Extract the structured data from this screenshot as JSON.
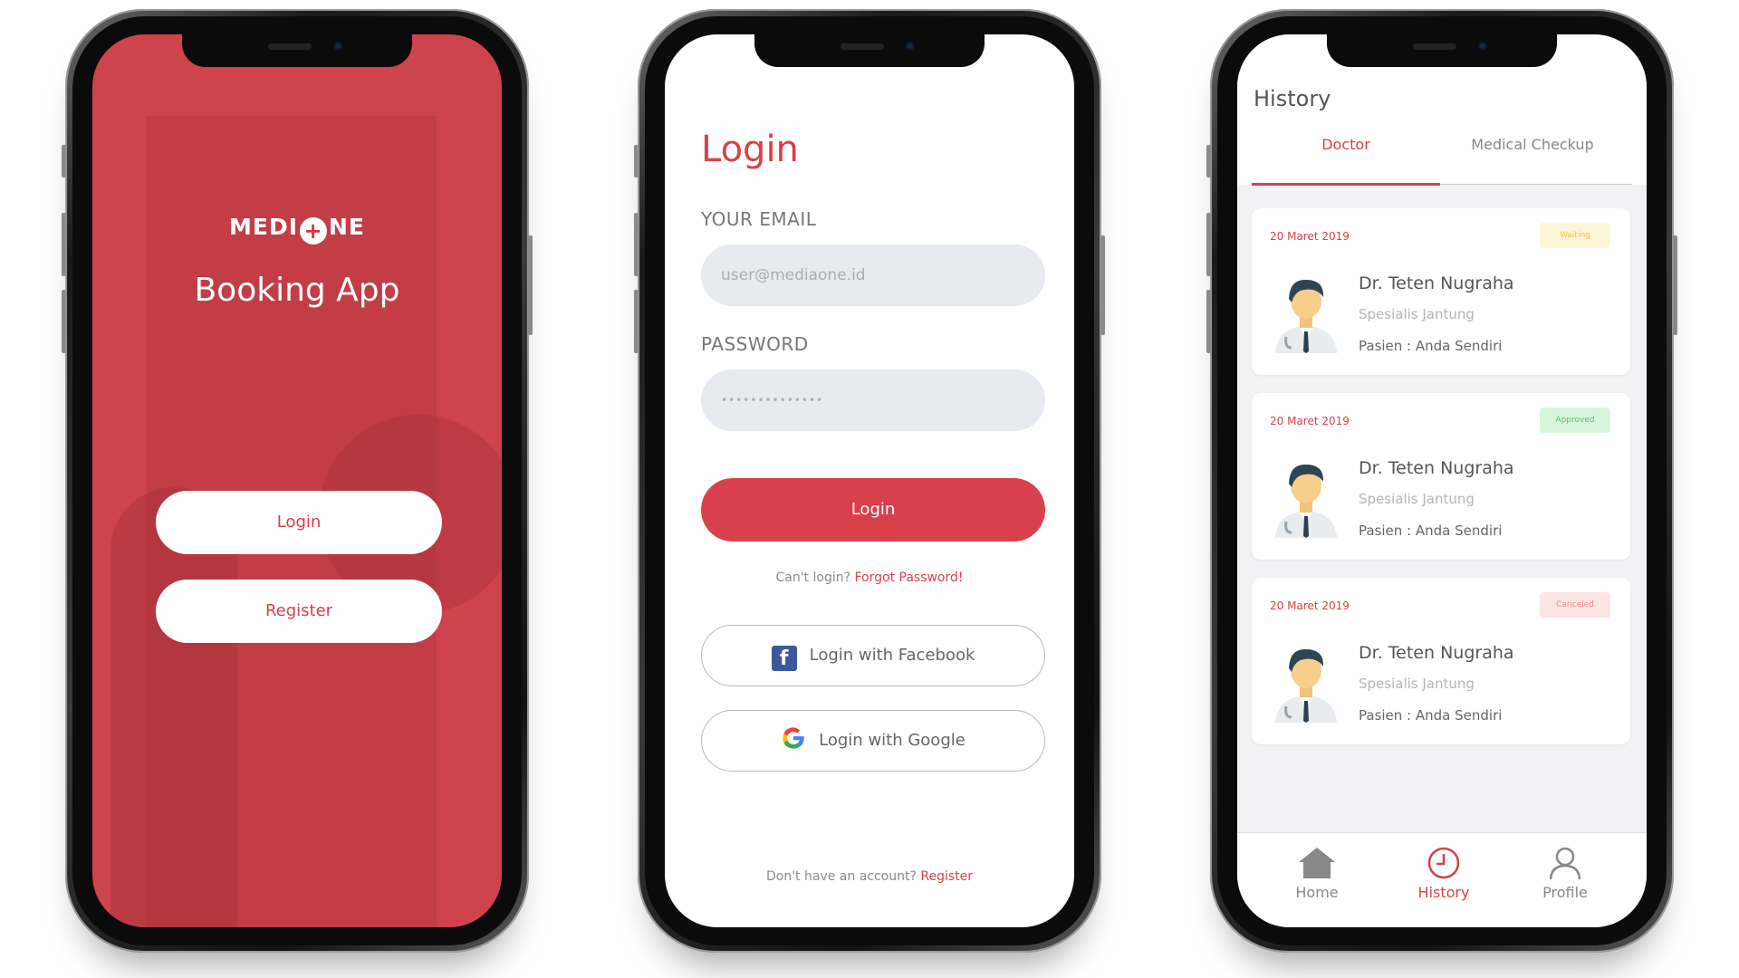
{
  "screen1": {
    "logo_left": "MEDI",
    "logo_right": "NE",
    "app_title": "Booking App",
    "login_label": "Login",
    "register_label": "Register"
  },
  "screen2": {
    "title": "Login",
    "email_label": "YOUR EMAIL",
    "email_value": "user@mediaone.id",
    "password_label": "PASSWORD",
    "password_value": "••••••••••••••",
    "login_button": "Login",
    "cant_login": "Can't login?",
    "forgot_password": "Forgot Password!",
    "facebook_button": "Login with Facebook",
    "google_button": "Login with Google",
    "no_account": "Don't have an account?",
    "register_link": "Register"
  },
  "screen3": {
    "title": "History",
    "tabs": [
      {
        "label": "Doctor"
      },
      {
        "label": "Medical Checkup"
      }
    ],
    "cards": [
      {
        "date": "20 Maret 2019",
        "status": "Waiting",
        "status_color": "#e6c452",
        "doctor": "Dr. Teten Nugraha",
        "specialty": "Spesialis Jantung",
        "patient": "Pasien : Anda Sendiri"
      },
      {
        "date": "20 Maret 2019",
        "status": "Approved",
        "status_color": "#5bbf6a",
        "doctor": "Dr. Teten Nugraha",
        "specialty": "Spesialis Jantung",
        "patient": "Pasien : Anda Sendiri"
      },
      {
        "date": "20 Maret 2019",
        "status": "Canceled",
        "status_color": "#ec8a8a",
        "doctor": "Dr. Teten Nugraha",
        "specialty": "Spesialis Jantung",
        "patient": "Pasien : Anda Sendiri"
      }
    ],
    "nav": [
      {
        "label": "Home",
        "icon": "home-icon"
      },
      {
        "label": "History",
        "icon": "clock-icon"
      },
      {
        "label": "Profile",
        "icon": "user-icon"
      }
    ]
  },
  "colors": {
    "brand_red": "#d8404b",
    "splash_background": "#cf434d",
    "field_background": "#e7eaee",
    "facebook_blue": "#3b5998"
  }
}
